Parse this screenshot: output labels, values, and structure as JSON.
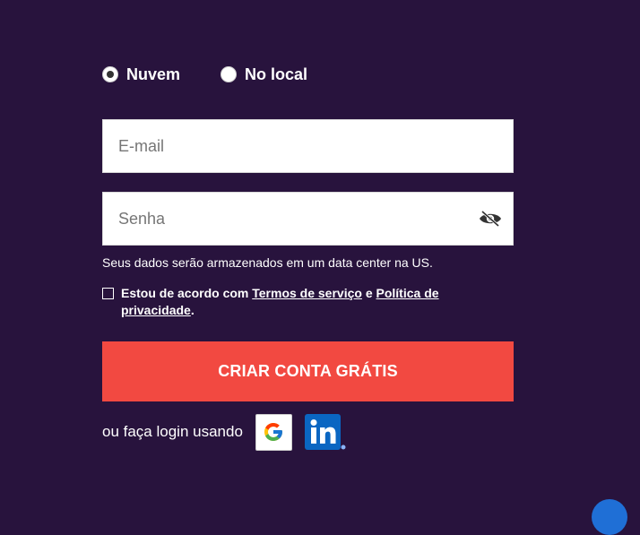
{
  "deployment": {
    "options": [
      {
        "label": "Nuvem",
        "selected": true
      },
      {
        "label": "No local",
        "selected": false
      }
    ]
  },
  "form": {
    "email_placeholder": "E-mail",
    "password_placeholder": "Senha",
    "storage_note": "Seus dados serão armazenados em um data center na US.",
    "terms": {
      "prefix": "Estou de acordo com ",
      "terms_link": "Termos de serviço",
      "connector": " e ",
      "privacy_link": "Política de privacidade",
      "suffix": ".",
      "checked": false
    },
    "submit_label": "CRIAR CONTA GRÁTIS"
  },
  "social": {
    "label": "ou faça login usando",
    "providers": [
      "google-icon",
      "linkedin-icon"
    ]
  },
  "colors": {
    "background": "#28133d",
    "cta": "#f24941",
    "linkedin": "#0a66c2"
  }
}
